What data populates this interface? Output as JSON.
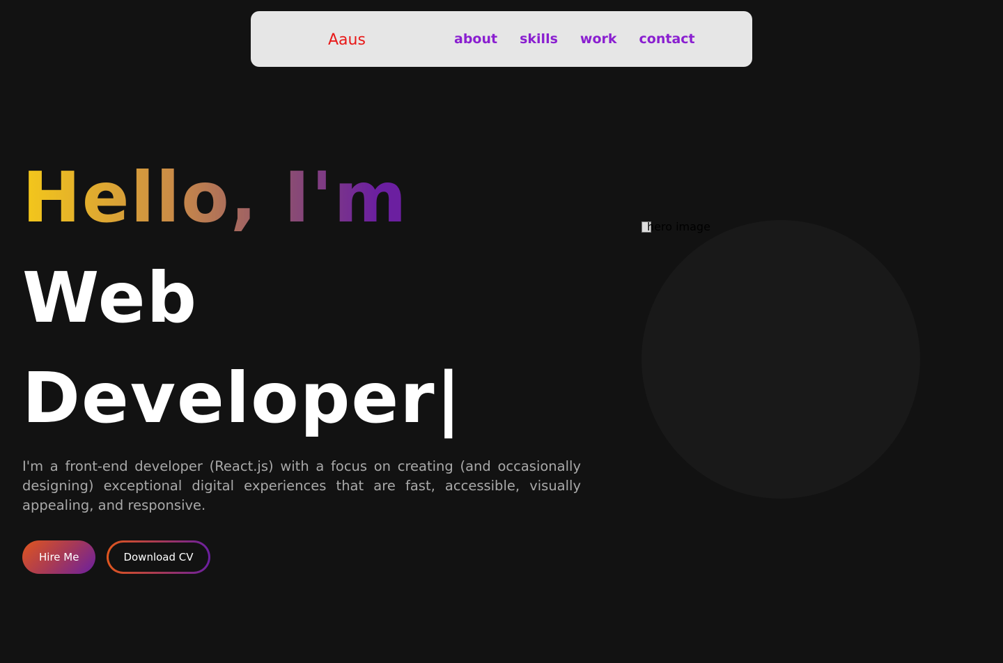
{
  "nav": {
    "logo_text": "Aaus",
    "links": [
      {
        "label": "about"
      },
      {
        "label": "skills"
      },
      {
        "label": "work"
      },
      {
        "label": "contact"
      }
    ]
  },
  "hero": {
    "greeting": "Hello, I'm",
    "role_line1": "Web",
    "role_line2": "Developer|",
    "description": "I'm a front-end developer (React.js) with a focus on creating (and occasionally designing) exceptional digital experiences that are fast, accessible, visually appealing, and responsive.",
    "primary_button": "Hire Me",
    "secondary_button": "Download CV",
    "image_alt": "hero image"
  },
  "colors": {
    "background": "#121212",
    "nav_background": "#e6e6e6",
    "nav_link": "#8a1fd0",
    "logo": "#e81818",
    "gradient_start": "#f4c81a",
    "gradient_end": "#6b1fa0"
  }
}
